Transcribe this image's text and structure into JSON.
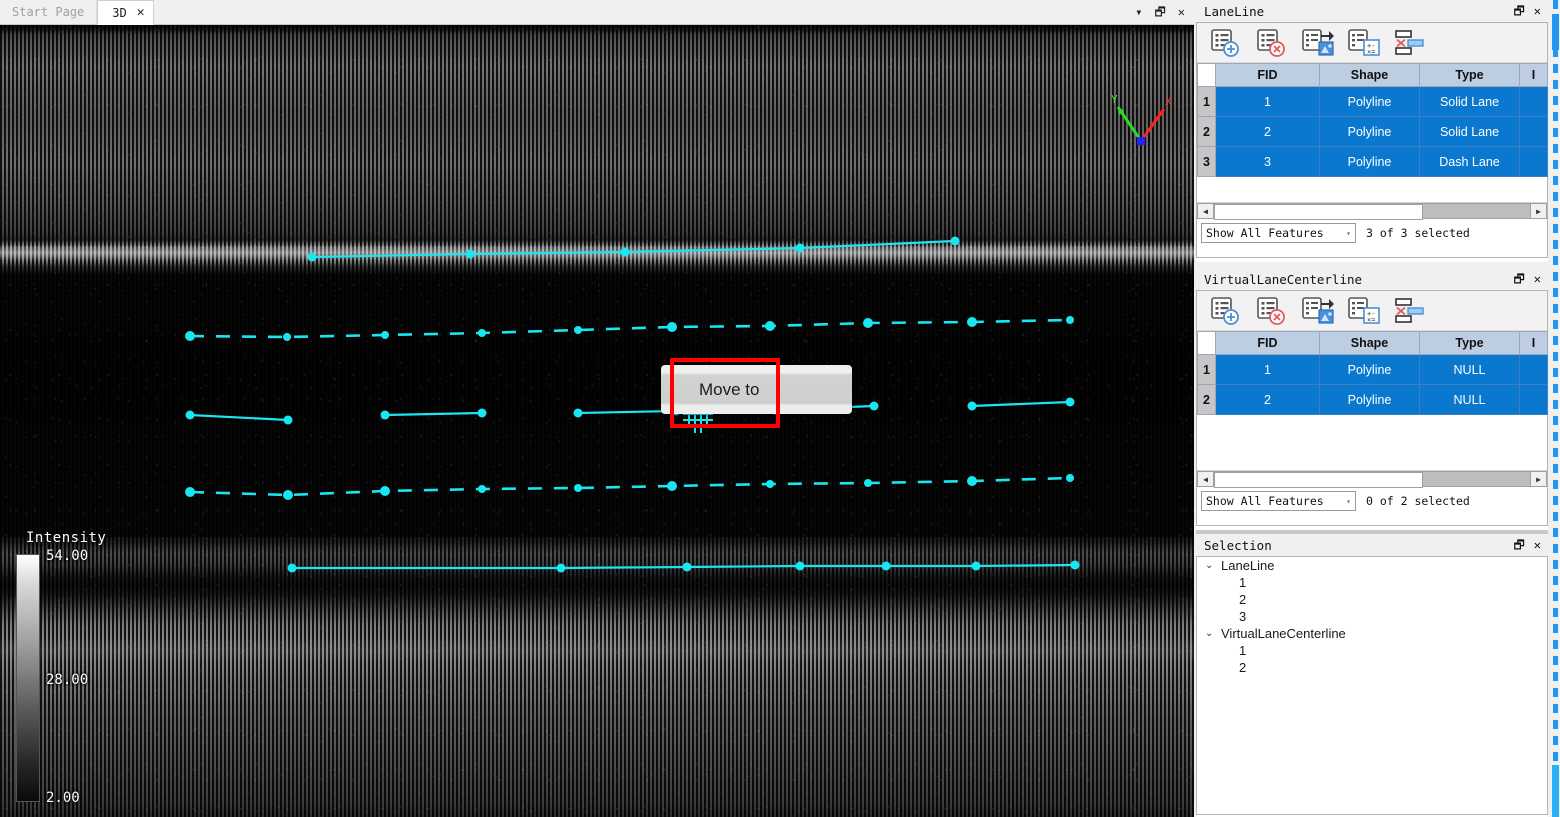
{
  "window": {
    "tabs": [
      {
        "label": "Start Page",
        "active": false,
        "closable": false
      },
      {
        "label": "3D",
        "active": true,
        "closable": true,
        "close_glyph": "✕"
      }
    ],
    "tab_controls": [
      {
        "name": "tab-list-dropdown",
        "glyph": "▾"
      },
      {
        "name": "restore-window",
        "glyph": "🗗"
      },
      {
        "name": "close-window",
        "glyph": "✕"
      }
    ]
  },
  "viewport": {
    "context_menu": {
      "label": "Move to"
    },
    "legend": {
      "title": "Intensity",
      "max": "54.00",
      "mid": "28.00",
      "min": "2.00"
    },
    "gizmo": {
      "x_label": "X",
      "y_label": "Y",
      "x_color": "#ff2020",
      "y_color": "#22dd22",
      "z_color": "#2222ff"
    },
    "lane_color": "#19e6f0",
    "highlight_color": "#ff0000"
  },
  "panels": [
    {
      "id": "laneline",
      "title": "LaneLine",
      "window_buttons": [
        {
          "name": "float-panel",
          "glyph": "🗗"
        },
        {
          "name": "close-panel",
          "glyph": "✕"
        }
      ],
      "toolbar": [
        {
          "name": "add-record-icon",
          "tip": "Add record"
        },
        {
          "name": "delete-record-icon",
          "tip": "Delete record"
        },
        {
          "name": "export-table-icon",
          "tip": "Export table"
        },
        {
          "name": "calculate-field-icon",
          "tip": "Calculate field"
        },
        {
          "name": "delete-field-icon",
          "tip": "Delete field"
        }
      ],
      "columns": [
        "FID",
        "Shape",
        "Type",
        "I"
      ],
      "rows": [
        {
          "n": "1",
          "FID": "1",
          "Shape": "Polyline",
          "Type": "Solid Lane",
          "I": ""
        },
        {
          "n": "2",
          "FID": "2",
          "Shape": "Polyline",
          "Type": "Solid Lane",
          "I": ""
        },
        {
          "n": "3",
          "FID": "3",
          "Shape": "Polyline",
          "Type": "Dash Lane",
          "I": ""
        }
      ],
      "filter": {
        "value": "Show All Features",
        "caret": "▾"
      },
      "selection_status": "3 of 3 selected"
    },
    {
      "id": "virtuallanecenterline",
      "title": "VirtualLaneCenterline",
      "window_buttons": [
        {
          "name": "float-panel",
          "glyph": "🗗"
        },
        {
          "name": "close-panel",
          "glyph": "✕"
        }
      ],
      "toolbar": [
        {
          "name": "add-record-icon",
          "tip": "Add record"
        },
        {
          "name": "delete-record-icon",
          "tip": "Delete record"
        },
        {
          "name": "export-table-icon",
          "tip": "Export table"
        },
        {
          "name": "calculate-field-icon",
          "tip": "Calculate field"
        },
        {
          "name": "delete-field-icon",
          "tip": "Delete field"
        }
      ],
      "columns": [
        "FID",
        "Shape",
        "Type",
        "I"
      ],
      "rows": [
        {
          "n": "1",
          "FID": "1",
          "Shape": "Polyline",
          "Type": "NULL",
          "I": ""
        },
        {
          "n": "2",
          "FID": "2",
          "Shape": "Polyline",
          "Type": "NULL",
          "I": ""
        }
      ],
      "filter": {
        "value": "Show All Features",
        "caret": "▾"
      },
      "selection_status": "0 of 2 selected"
    }
  ],
  "selection_panel": {
    "title": "Selection",
    "window_buttons": [
      {
        "name": "float-panel",
        "glyph": "🗗"
      },
      {
        "name": "close-panel",
        "glyph": "✕"
      }
    ],
    "groups": [
      {
        "caret": "⌄",
        "label": "LaneLine",
        "children": [
          "1",
          "2",
          "3"
        ]
      },
      {
        "caret": "⌄",
        "label": "VirtualLaneCenterline",
        "children": [
          "1",
          "2"
        ]
      }
    ]
  }
}
